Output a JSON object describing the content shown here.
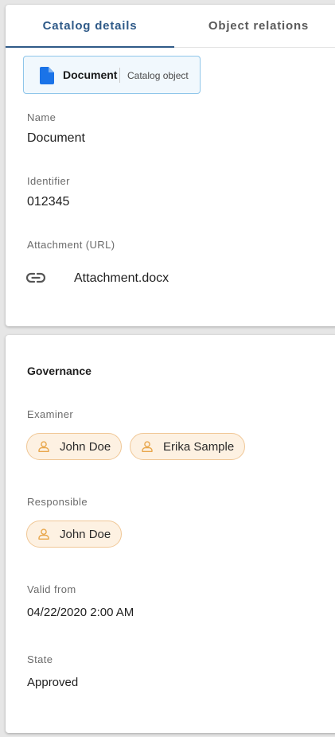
{
  "tabs": [
    {
      "label": "Catalog details",
      "active": true
    },
    {
      "label": "Object relations",
      "active": false
    }
  ],
  "object_type": {
    "name": "Document",
    "subtitle": "Catalog object",
    "icon": "document-icon",
    "color": "#1a73e8"
  },
  "details": {
    "name_label": "Name",
    "name_value": "Document",
    "identifier_label": "Identifier",
    "identifier_value": "012345",
    "attachment_label": "Attachment (URL)",
    "attachment_icon": "link-icon",
    "attachment_value": "Attachment.docx"
  },
  "governance": {
    "title": "Governance",
    "examiner_label": "Examiner",
    "examiners": [
      "John Doe",
      "Erika Sample"
    ],
    "responsible_label": "Responsible",
    "responsible": [
      "John Doe"
    ],
    "valid_from_label": "Valid from",
    "valid_from_value": "04/22/2020 2:00 AM",
    "state_label": "State",
    "state_value": "Approved",
    "person_icon": "person-icon",
    "person_chip_color": "#fdf1e2"
  },
  "colors": {
    "accent": "#2f5a88",
    "chip_border": "#f0c796",
    "person_icon": "#e8a64a"
  }
}
